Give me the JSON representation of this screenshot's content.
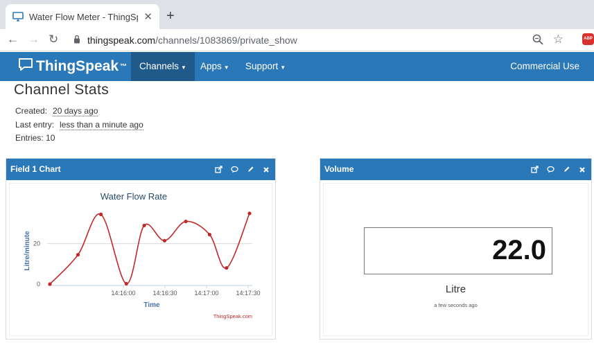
{
  "browser": {
    "tab_title": "Water Flow Meter - ThingSpeak I",
    "url_domain": "thingspeak.com",
    "url_path": "/channels/1083869/private_show",
    "extension_badge": "ABP"
  },
  "navbar": {
    "brand": "ThingSpeak",
    "brand_tm": "™",
    "items": [
      "Channels",
      "Apps",
      "Support"
    ],
    "right_link": "Commercial Use",
    "color": "#2b78b8"
  },
  "stats": {
    "title": "Channel Stats",
    "created_label": "Created:",
    "created_value": "20 days ago",
    "last_entry_label": "Last entry:",
    "last_entry_value": "less than a minute ago",
    "entries_text": "Entries: 10"
  },
  "chart_panel": {
    "header": "Field 1 Chart",
    "credit": "ThingSpeak.com"
  },
  "lamp_panel": {
    "header": "Volume",
    "value": "22.0",
    "unit": "Litre",
    "timestamp": "a few seconds ago"
  },
  "chart_data": {
    "type": "line",
    "title": "Water Flow Rate",
    "xlabel": "Time",
    "ylabel": "Litre/minute",
    "x_ticks": [
      "14:16:00",
      "14:16:30",
      "14:17:00",
      "14:17:30"
    ],
    "y_ticks": [
      0,
      20
    ],
    "ylim": [
      0,
      36
    ],
    "x_seconds_range": [
      -55,
      93
    ],
    "x_seconds": [
      -53,
      -20,
      7,
      37,
      58,
      82,
      107,
      135,
      155,
      182
    ],
    "y": [
      0,
      14.5,
      34.5,
      0.2,
      29,
      21.5,
      31,
      24.5,
      8,
      35
    ],
    "color": "#c0282a",
    "grid": true
  }
}
